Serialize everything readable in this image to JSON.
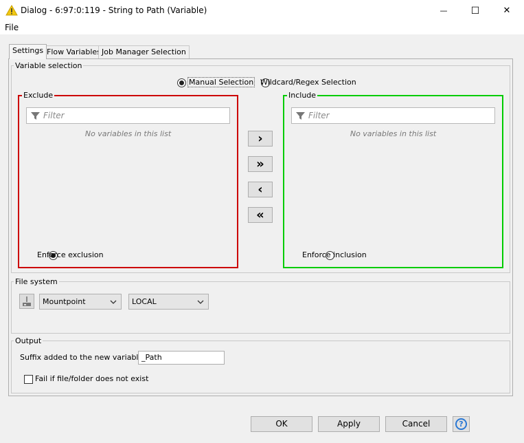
{
  "window": {
    "title": "Dialog - 6:97:0:119 - String to Path (Variable)",
    "minimize_glyph": "—",
    "maximize_glyph": "☐",
    "close_glyph": "✕"
  },
  "menu": {
    "file": "File"
  },
  "tabs": [
    {
      "label": "Settings",
      "active": true
    },
    {
      "label": "Flow Variables",
      "active": false
    },
    {
      "label": "Job Manager Selection",
      "active": false
    }
  ],
  "variable_selection": {
    "title": "Variable selection",
    "mode_options": [
      {
        "label": "Manual Selection",
        "selected": true
      },
      {
        "label": "Wildcard/Regex Selection",
        "selected": false
      }
    ],
    "exclude": {
      "title": "Exclude",
      "border_color": "#cc0000",
      "filter_placeholder": "Filter",
      "empty_message": "No variables in this list",
      "enforce_label": "Enforce exclusion",
      "enforce_selected": true
    },
    "include": {
      "title": "Include",
      "border_color": "#00cc00",
      "filter_placeholder": "Filter",
      "empty_message": "No variables in this list",
      "enforce_label": "Enforce inclusion",
      "enforce_selected": false
    },
    "move_buttons": [
      {
        "name": "add",
        "glyph": "›"
      },
      {
        "name": "add-all",
        "glyph": "»"
      },
      {
        "name": "remove",
        "glyph": "‹"
      },
      {
        "name": "remove-all",
        "glyph": "«"
      }
    ]
  },
  "file_system": {
    "title": "File system",
    "type_value": "Mountpoint",
    "location_value": "LOCAL"
  },
  "output": {
    "title": "Output",
    "suffix_label": "Suffix added to the new variables:",
    "suffix_value": "_Path",
    "fail_label": "Fail if file/folder does not exist",
    "fail_checked": false
  },
  "buttons": {
    "ok": "OK",
    "apply": "Apply",
    "cancel": "Cancel",
    "help": "?"
  }
}
